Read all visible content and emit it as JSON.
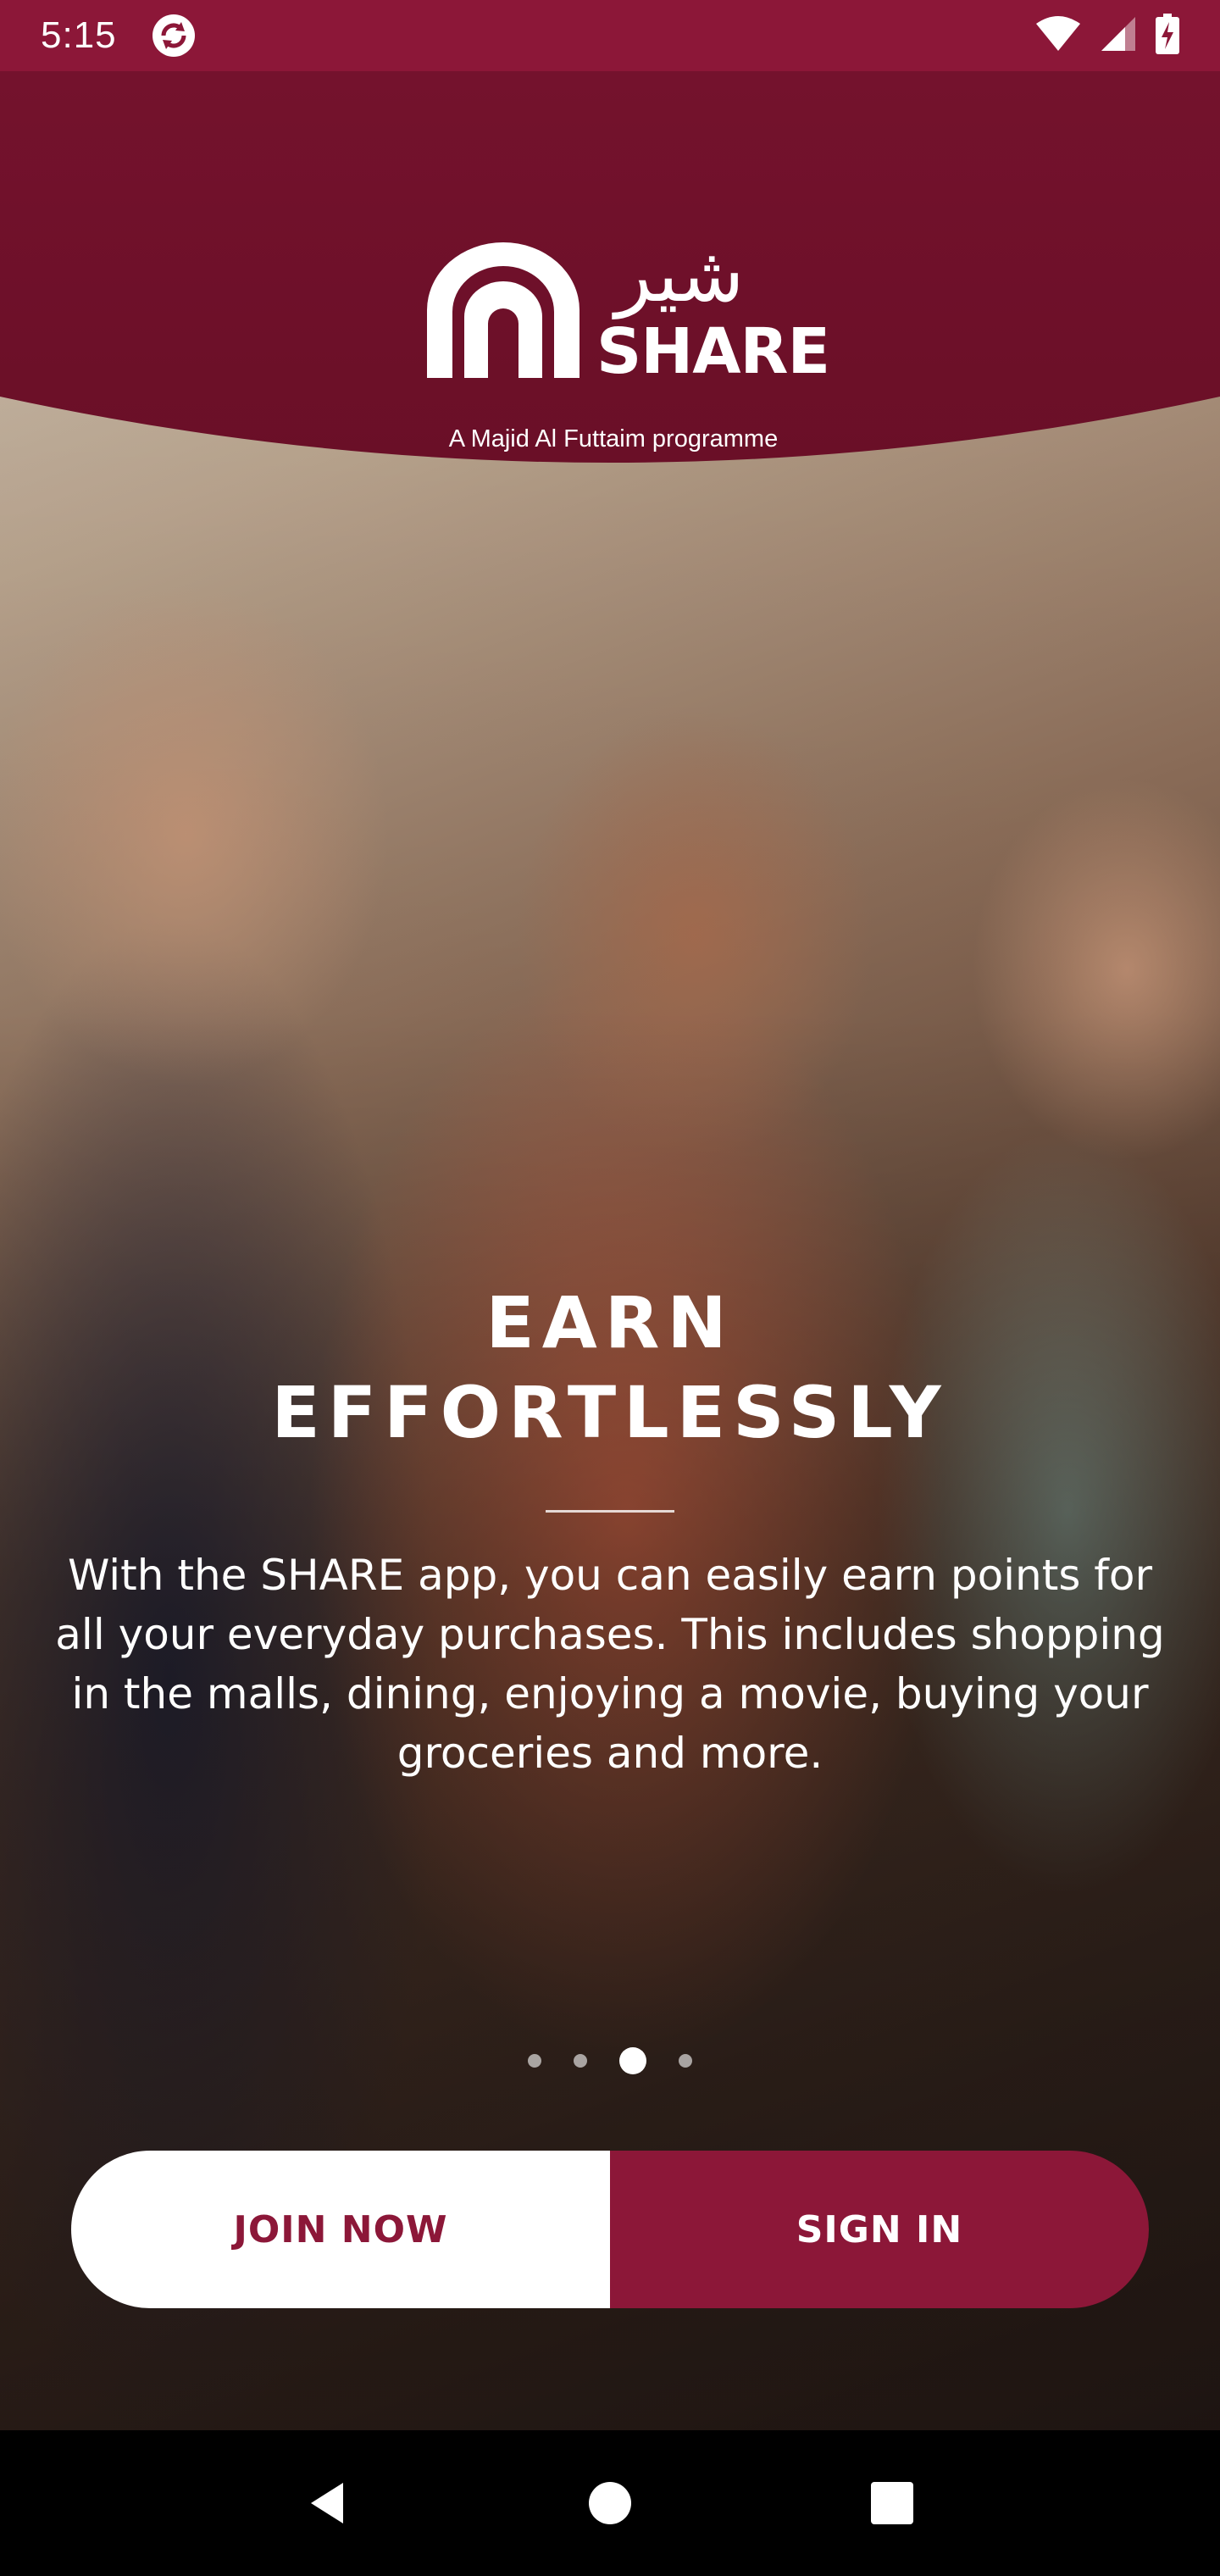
{
  "status_bar": {
    "time": "5:15",
    "icons": [
      "sync-icon",
      "wifi-icon",
      "signal-icon",
      "battery-charging-icon"
    ]
  },
  "brand": {
    "name": "SHARE",
    "arabic_name": "شير",
    "tagline": "A Majid Al Futtaim programme",
    "primary_color": "#8c1738",
    "header_color": "#6e1128"
  },
  "slide": {
    "title_line1": "EARN",
    "title_line2": "EFFORTLESSLY",
    "body": "With the SHARE app, you can easily earn points for all your everyday purchases. This includes shopping in the malls, dining, enjoying a movie, buying your groceries and more.",
    "page_count": 4,
    "active_page": 3
  },
  "actions": {
    "join_label": "JOIN NOW",
    "signin_label": "SIGN IN"
  },
  "nav": {
    "icons": [
      "back-icon",
      "home-icon",
      "recents-icon"
    ]
  }
}
